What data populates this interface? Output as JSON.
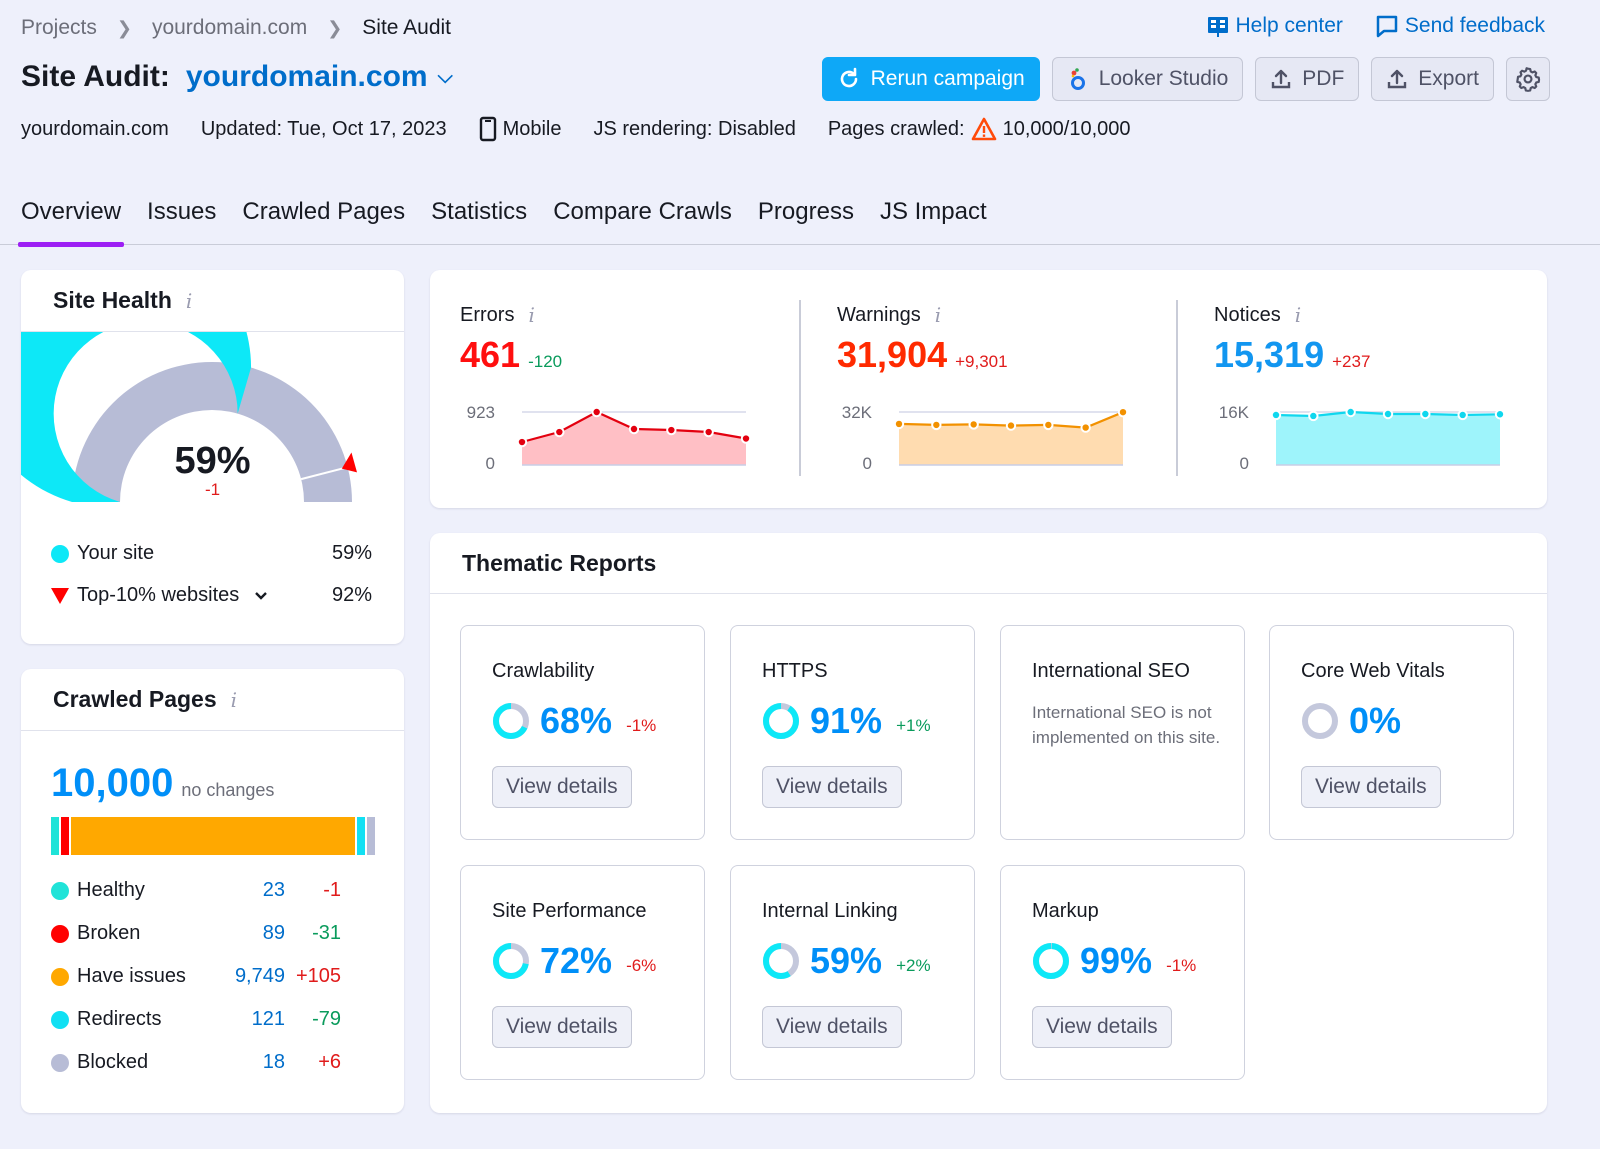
{
  "breadcrumb": [
    "Projects",
    "yourdomain.com",
    "Site Audit"
  ],
  "top_links": {
    "help": "Help center",
    "feedback": "Send feedback"
  },
  "header": {
    "title_prefix": "Site Audit:",
    "domain": "yourdomain.com"
  },
  "actions": {
    "rerun": "Rerun campaign",
    "looker": "Looker Studio",
    "pdf": "PDF",
    "export": "Export"
  },
  "meta": {
    "domain": "yourdomain.com",
    "updated": "Updated: Tue, Oct 17, 2023",
    "device": "Mobile",
    "js_rendering": "JS rendering: Disabled",
    "pages_crawled_label": "Pages crawled:",
    "pages_crawled_value": "10,000/10,000"
  },
  "tabs": [
    "Overview",
    "Issues",
    "Crawled Pages",
    "Statistics",
    "Compare Crawls",
    "Progress",
    "JS Impact"
  ],
  "active_tab": "Overview",
  "site_health": {
    "title": "Site Health",
    "value": "59%",
    "percent": 59,
    "top10_percent": 92,
    "delta": "-1",
    "legend": [
      {
        "label": "Your site",
        "value": "59%"
      },
      {
        "label": "Top-10% websites",
        "value": "92%"
      }
    ]
  },
  "crawled_pages": {
    "title": "Crawled Pages",
    "total": "10,000",
    "change": "no changes",
    "rows": [
      {
        "label": "Healthy",
        "value": "23",
        "delta": "-1",
        "delta_type": "neg",
        "color": "#20e3d8",
        "count": 23
      },
      {
        "label": "Broken",
        "value": "89",
        "delta": "-31",
        "delta_type": "pos",
        "color": "#ff0000",
        "count": 89
      },
      {
        "label": "Have issues",
        "value": "9,749",
        "delta": "+105",
        "delta_type": "neg",
        "color": "#ffa800",
        "count": 9749
      },
      {
        "label": "Redirects",
        "value": "121",
        "delta": "-79",
        "delta_type": "pos",
        "color": "#11e0f3",
        "count": 121
      },
      {
        "label": "Blocked",
        "value": "18",
        "delta": "+6",
        "delta_type": "neg",
        "color": "#b7bcd6",
        "count": 18
      }
    ]
  },
  "issues": [
    {
      "name": "Errors",
      "value": "461",
      "delta": "-120",
      "delta_type": "pos",
      "value_color": "#ff0f0f",
      "line": "#e3000f",
      "fill": "#ffbfc5",
      "ymax_label": "923",
      "ymin_label": "0",
      "ymax": 923,
      "points": [
        400,
        574,
        923,
        627,
        609,
        574,
        461
      ]
    },
    {
      "name": "Warnings",
      "value": "31,904",
      "delta": "+9,301",
      "delta_type": "neg",
      "value_color": "#ff2a00",
      "line": "#f29100",
      "fill": "#ffdcb0",
      "ymax_label": "32K",
      "ymin_label": "0",
      "ymax": 32000,
      "points": [
        24800,
        24200,
        24500,
        23800,
        24200,
        22600,
        31904
      ]
    },
    {
      "name": "Notices",
      "value": "15,319",
      "delta": "+237",
      "delta_type": "neg",
      "value_color": "#1296f0",
      "line": "#10d7ee",
      "fill": "#9ef4fb",
      "ymax_label": "16K",
      "ymin_label": "0",
      "ymax": 16000,
      "points": [
        15100,
        14800,
        16000,
        15400,
        15400,
        15100,
        15319
      ]
    }
  ],
  "thematic": {
    "title": "Thematic Reports",
    "button_label": "View details",
    "reports": [
      {
        "name": "Crawlability",
        "value": "68%",
        "percent": 68,
        "delta": "-1%",
        "delta_type": "neg"
      },
      {
        "name": "HTTPS",
        "value": "91%",
        "percent": 91,
        "delta": "+1%",
        "delta_type": "pos"
      },
      {
        "name": "International SEO",
        "description": "International SEO is not implemented on this site."
      },
      {
        "name": "Core Web Vitals",
        "value": "0%",
        "percent": 0,
        "delta": "",
        "delta_type": ""
      },
      {
        "name": "Site Performance",
        "value": "72%",
        "percent": 72,
        "delta": "-6%",
        "delta_type": "neg"
      },
      {
        "name": "Internal Linking",
        "value": "59%",
        "percent": 59,
        "delta": "+2%",
        "delta_type": "pos"
      },
      {
        "name": "Markup",
        "value": "99%",
        "percent": 99,
        "delta": "-1%",
        "delta_type": "neg"
      }
    ]
  },
  "colors": {
    "accent": "#006dca",
    "primary_button": "#0ea8f7",
    "tab_active": "#9d1ff4",
    "gauge_fill": "#0de8f7",
    "gauge_track": "#b7bcd6"
  }
}
